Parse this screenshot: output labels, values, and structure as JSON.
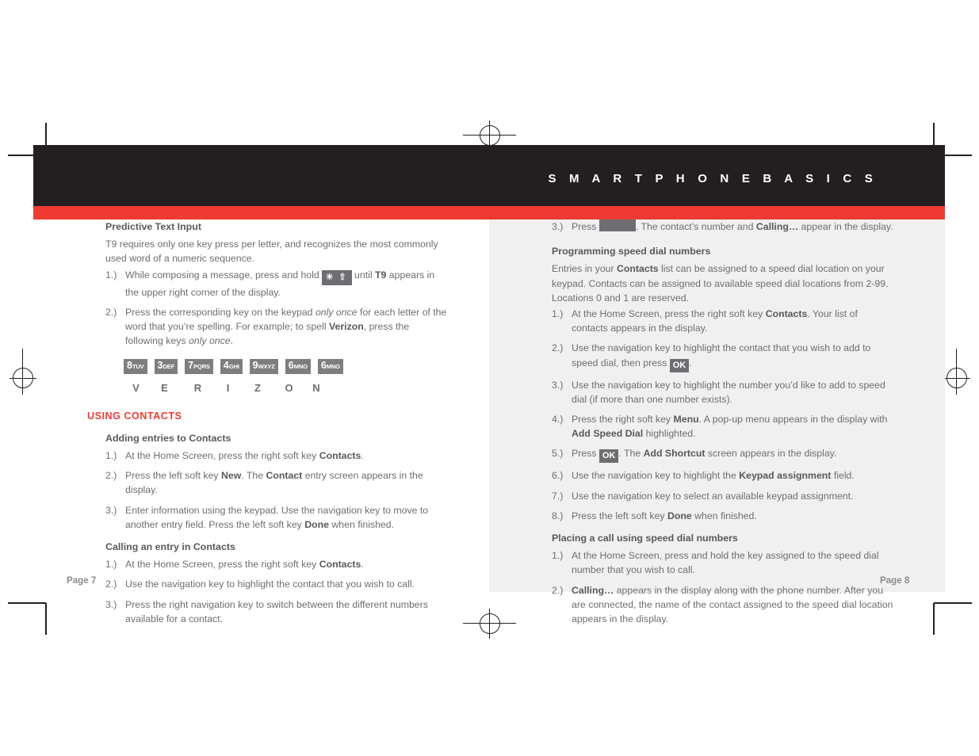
{
  "document": {
    "banner_title": "S M A R T P H O N E   B A S I C S",
    "colors": {
      "banner_black": "#231f20",
      "accent_red": "#ef3b33",
      "body_gray": "#6d6e71",
      "page_tint": "#f0f0f0"
    },
    "page_left_label": "Page 7",
    "page_right_label": "Page 8"
  },
  "left_column": {
    "predictive": {
      "heading": "Predictive Text Input",
      "intro": "T9 requires only one key press per letter, and recognizes the most commonly used word of a numeric sequence.",
      "steps": [
        {
          "num": "1.)",
          "pre": "While composing a message, press and hold ",
          "key": "✳ ⇧",
          "mid": " until ",
          "bold": "T9",
          "post": " appears in the upper right corner of the display."
        },
        {
          "num": "2.)",
          "pre": "Press the corresponding key on the keypad ",
          "ital1": "only once",
          "mid": " for each letter of the word that you’re spelling. For example; to spell ",
          "bold": "Verizon",
          "post": ", press the following keys ",
          "ital2": "only once",
          "end": "."
        }
      ],
      "keypad": [
        {
          "digit": "8",
          "letters": "TUV",
          "maps_to": "V"
        },
        {
          "digit": "3",
          "letters": "DEF",
          "maps_to": "E"
        },
        {
          "digit": "7",
          "letters": "PQRS",
          "maps_to": "R"
        },
        {
          "digit": "4",
          "letters": "GHI",
          "maps_to": "I"
        },
        {
          "digit": "9",
          "letters": "WXYZ",
          "maps_to": "Z"
        },
        {
          "digit": "6",
          "letters": "MNO",
          "maps_to": "O"
        },
        {
          "digit": "6",
          "letters": "MNO",
          "maps_to": "N"
        }
      ]
    },
    "using_contacts": {
      "section_heading": "USING CONTACTS",
      "adding": {
        "heading": "Adding entries to Contacts",
        "steps": [
          {
            "num": "1.)",
            "pre": "At the Home Screen, press the right soft key ",
            "bold": "Contacts",
            "post": "."
          },
          {
            "num": "2.)",
            "pre": "Press the left soft key ",
            "bold": "New",
            "post": ". The ",
            "bold2": "Contact",
            "post2": " entry screen appears in the display."
          },
          {
            "num": "3.)",
            "pre": "Enter information using the keypad. Use the navigation key to move to another entry field. Press the left soft key ",
            "bold": "Done",
            "post": " when finished."
          }
        ]
      },
      "calling": {
        "heading": "Calling an entry in Contacts",
        "steps": [
          {
            "num": "1.)",
            "pre": "At the Home Screen, press the right soft key ",
            "bold": "Contacts",
            "post": "."
          },
          {
            "num": "2.)",
            "pre": "Use the navigation key to highlight the contact that you wish to call.",
            "bold": "",
            "post": ""
          },
          {
            "num": "3.)",
            "pre": "Press the right navigation key to switch between the different numbers available for a contact.",
            "bold": "",
            "post": ""
          }
        ]
      }
    }
  },
  "right_column": {
    "continued_step": {
      "num": "3.)",
      "pre": "Press ",
      "key_blank": "",
      "mid": ". The contact’s number and ",
      "bold": "Calling…",
      "post": " appear in the display."
    },
    "programming": {
      "heading": "Programming speed dial numbers",
      "intro_pre": "Entries in your ",
      "intro_bold": "Contacts",
      "intro_post": " list can be assigned to a speed dial location on your keypad. Contacts can be assigned to available speed dial locations from 2-99. Locations 0 and 1 are reserved.",
      "steps": [
        {
          "num": "1.)",
          "pre": "At the Home Screen, press the right soft key ",
          "bold": "Contacts",
          "post": ". Your list of contacts appears in the display."
        },
        {
          "num": "2.)",
          "pre": "Use the navigation key to highlight the contact that you wish to add to speed dial, then press ",
          "key": "OK",
          "post": "."
        },
        {
          "num": "3.)",
          "pre": "Use the navigation key to highlight the number you’d like to add to speed dial (if more than one number exists).",
          "bold": "",
          "post": ""
        },
        {
          "num": "4.)",
          "pre": "Press the right soft key ",
          "bold": "Menu",
          "post": ". A pop-up menu appears in the display with ",
          "bold2": "Add Speed Dial",
          "post2": " highlighted."
        },
        {
          "num": "5.)",
          "pre": "Press ",
          "key": "OK",
          "post": ". The ",
          "bold2": "Add Shortcut",
          "post2": " screen appears in the display."
        },
        {
          "num": "6.)",
          "pre": "Use the navigation key to highlight the ",
          "bold": "Keypad assignment",
          "post": " field."
        },
        {
          "num": "7.)",
          "pre": "Use the navigation key to select an available keypad assignment.",
          "bold": "",
          "post": ""
        },
        {
          "num": "8.)",
          "pre": "Press the left soft key ",
          "bold": "Done",
          "post": " when finished."
        }
      ]
    },
    "placing_call": {
      "heading": "Placing a call using speed dial numbers",
      "steps": [
        {
          "num": "1.)",
          "pre": "At the Home Screen, press and hold the key assigned to the speed dial number that you wish to call.",
          "bold": "",
          "post": ""
        },
        {
          "num": "2.)",
          "pre": "",
          "bold": "Calling…",
          "post": " appears in the display along with the phone number. After you are connected, the name of the contact assigned to the speed dial location appears in the display."
        }
      ]
    }
  }
}
